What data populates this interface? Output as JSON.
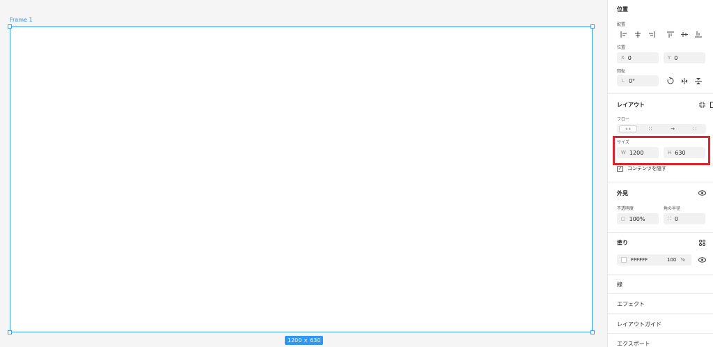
{
  "canvas": {
    "frame_name": "Frame 1",
    "size_badge": "1200 × 630"
  },
  "panel": {
    "position": {
      "title": "位置",
      "align_label": "配置",
      "position_label": "位置",
      "x_prefix": "X",
      "x_value": "0",
      "y_prefix": "Y",
      "y_value": "0",
      "rotation_label": "回転",
      "rotation_value": "0°"
    },
    "layout": {
      "title": "レイアウト",
      "flow_label": "フロー",
      "size_label": "サイズ",
      "w_prefix": "W",
      "w_value": "1200",
      "h_prefix": "H",
      "h_value": "630",
      "clip_label": "コンテンツを隠す"
    },
    "appearance": {
      "title": "外見",
      "opacity_label": "不透明度",
      "opacity_value": "100%",
      "radius_label": "角の半径",
      "radius_value": "0"
    },
    "fill": {
      "title": "塗り",
      "hex": "FFFFFF",
      "opacity": "100",
      "percent": "%"
    },
    "stroke_title": "線",
    "effects_title": "エフェクト",
    "layout_guide_title": "レイアウトガイド",
    "export_title": "エクスポート"
  },
  "colors": {
    "selection": "#3d9bf0",
    "highlight": "#d9262c",
    "fill_swatch": "#FFFFFF"
  }
}
